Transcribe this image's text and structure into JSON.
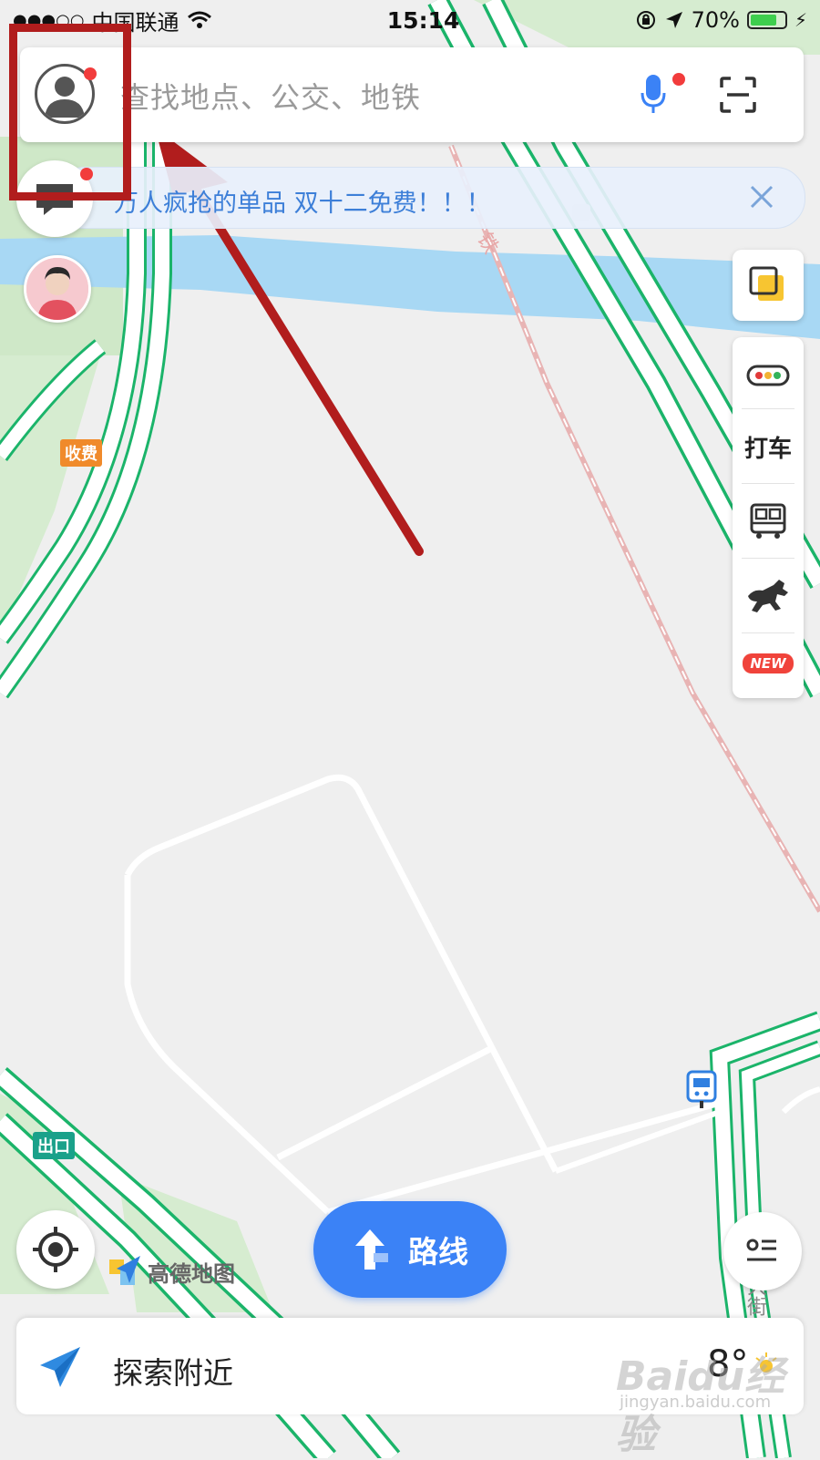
{
  "status_bar": {
    "signal": "●●●○○",
    "carrier": "中国联通",
    "time": "15:14",
    "battery": "70%"
  },
  "search": {
    "placeholder": "查找地点、公交、地铁"
  },
  "promo": {
    "text": "万人疯抢的单品 双十二免费！！！"
  },
  "toolbar": {
    "taxi_label": "打车",
    "new_badge": "NEW"
  },
  "map_labels": {
    "toll": "收费",
    "exit": "出口",
    "rail": "铁",
    "street": "大街"
  },
  "logo": {
    "text": "高德地图"
  },
  "route_button": {
    "label": "路线"
  },
  "bottom": {
    "explore_label": "探索附近",
    "temperature": "8°"
  },
  "watermark": {
    "brand": "Baidu经验",
    "url": "jingyan.baidu.com"
  },
  "colors": {
    "road_green": "#1bb46a",
    "water": "#a8d8f4",
    "park": "#cfe8c8",
    "accent_blue": "#3b82f6",
    "highlight_red": "#b11d1d",
    "badge_red": "#f23c3c"
  }
}
